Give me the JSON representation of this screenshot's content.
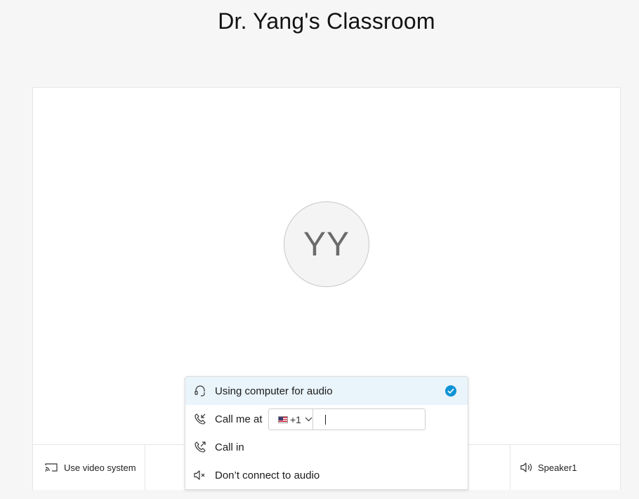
{
  "page": {
    "title": "Dr. Yang's Classroom"
  },
  "avatar": {
    "initials": "YY"
  },
  "bottom_bar": {
    "video_system_label": "Use video system",
    "speaker_label": "Speaker1"
  },
  "audio_menu": {
    "items": [
      {
        "label": "Using computer for audio",
        "icon": "headset-icon",
        "selected": true
      },
      {
        "label": "Call me at",
        "icon": "phone-callback-icon"
      },
      {
        "label": "Call in",
        "icon": "phone-outgoing-icon"
      },
      {
        "label": "Don’t connect to audio",
        "icon": "speaker-mute-icon"
      }
    ],
    "country_code": "+1",
    "phone_value": "",
    "accent_color": "#0d94d6"
  }
}
